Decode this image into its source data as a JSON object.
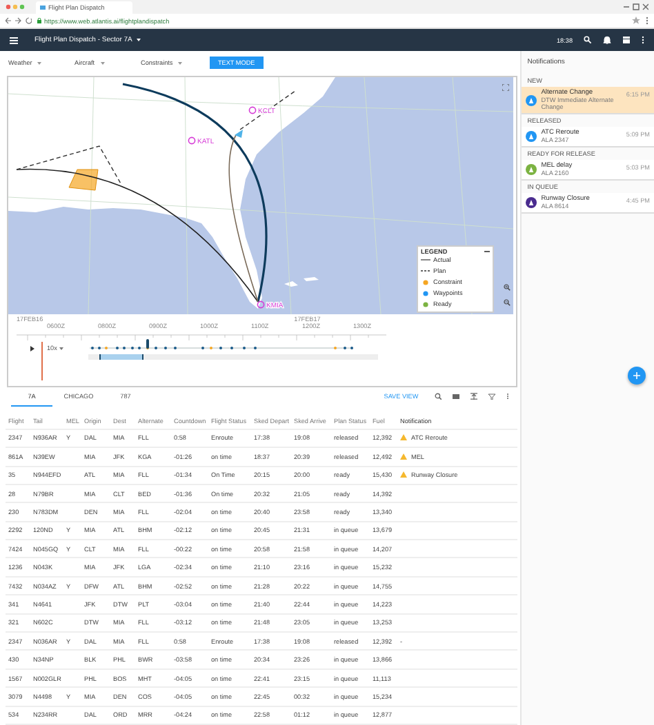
{
  "browser": {
    "tab_title": "Flight Plan Dispatch",
    "url": "https://www.web.atlantis.ai/flightplandispatch"
  },
  "app_bar": {
    "title": "Flight Plan Dispatch - Sector 7A",
    "time": "18:38"
  },
  "toolbar": {
    "menus": [
      "Weather",
      "Aircraft",
      "Constraints"
    ],
    "button": "TEXT MODE"
  },
  "map": {
    "airports": [
      {
        "code": "KCLT"
      },
      {
        "code": "KATL"
      },
      {
        "code": "KMIA"
      }
    ],
    "legend": {
      "title": "LEGEND",
      "items": [
        {
          "kind": "solid",
          "label": "Actual"
        },
        {
          "kind": "dashed",
          "label": "Plan"
        },
        {
          "kind": "dot",
          "color": "#f5a623",
          "label": "Constraint"
        },
        {
          "kind": "dot",
          "color": "#2196f3",
          "label": "Waypoints"
        },
        {
          "kind": "dot",
          "color": "#7cb342",
          "label": "Ready"
        }
      ]
    }
  },
  "timeline": {
    "dates": [
      "17FEB16",
      "17FEB17"
    ],
    "ticks": [
      "0600Z",
      "0800Z",
      "0900Z",
      "1000Z",
      "1100Z",
      "1200Z",
      "1300Z"
    ],
    "speed": "10x",
    "level": 0.15
  },
  "tabs": [
    {
      "label": "7A",
      "selected": true
    },
    {
      "label": "CHICAGO",
      "selected": false
    },
    {
      "label": "787",
      "selected": false
    }
  ],
  "save_view": "SAVE VIEW",
  "table": {
    "columns": [
      "Flight",
      "Tail",
      "MEL",
      "Origin",
      "Dest",
      "Alternate",
      "Countdown",
      "Flight Status",
      "Sked Depart",
      "Sked Arrive",
      "Plan Status",
      "Fuel",
      "Notification"
    ],
    "rows": [
      {
        "flight": "2347",
        "tail": "N936AR",
        "mel": "Y",
        "origin": "DAL",
        "dest": "MIA",
        "alternate": "FLL",
        "countdown": "0:58",
        "flight_status": "Enroute",
        "sked_depart": "17:38",
        "sked_arrive": "19:08",
        "plan_status": "released",
        "fuel": "12,392",
        "notification": {
          "text": "ATC Reroute",
          "warning": true
        }
      },
      {
        "flight": "861A",
        "tail": "N39EW",
        "origin": "MIA",
        "dest": "JFK",
        "alternate": "KGA",
        "countdown": "-01:26",
        "flight_status": "on time",
        "sked_depart": "18:37",
        "sked_arrive": "20:39",
        "plan_status": "released",
        "fuel": "12,492",
        "notification": {
          "text": "MEL",
          "warning": true
        }
      },
      {
        "flight": "35",
        "tail": "N944EFD",
        "origin": "ATL",
        "dest": "MIA",
        "alternate": "FLL",
        "countdown": "-01:34",
        "flight_status": "On Time",
        "sked_depart": "20:15",
        "sked_arrive": "20:00",
        "plan_status": "ready",
        "fuel": "15,430",
        "notification": {
          "text": "Runway Closure",
          "warning": true
        }
      },
      {
        "flight": "28",
        "tail": "N79BR",
        "origin": "MIA",
        "dest": "CLT",
        "alternate": "BED",
        "countdown": "-01:36",
        "flight_status": "On time",
        "sked_depart": "20:32",
        "sked_arrive": "21:05",
        "plan_status": "ready",
        "fuel": "14,392"
      },
      {
        "flight": "230",
        "tail": "N783DM",
        "origin": "DEN",
        "dest": "MIA",
        "alternate": "FLL",
        "countdown": "-02:04",
        "flight_status": "on time",
        "sked_depart": "20:40",
        "sked_arrive": "23:58",
        "plan_status": "ready",
        "fuel": "13,340"
      },
      {
        "flight": "2292",
        "tail": "120ND",
        "mel": "Y",
        "origin": "MIA",
        "dest": "ATL",
        "alternate": "BHM",
        "countdown": "-02:12",
        "flight_status": "on time",
        "sked_depart": "20:45",
        "sked_arrive": "21:31",
        "plan_status": "in queue",
        "fuel": "13,679"
      },
      {
        "flight": "7424",
        "tail": "N045GQ",
        "mel": "Y",
        "origin": "CLT",
        "dest": "MIA",
        "alternate": "FLL",
        "countdown": "-00:22",
        "flight_status": "on time",
        "sked_depart": "20:58",
        "sked_arrive": "21:58",
        "plan_status": "in queue",
        "fuel": "14,207"
      },
      {
        "flight": "1236",
        "tail": "N043K",
        "origin": "MIA",
        "dest": "JFK",
        "alternate": "LGA",
        "countdown": "-02:34",
        "flight_status": "on time",
        "sked_depart": "21:10",
        "sked_arrive": "23:16",
        "plan_status": "in queue",
        "fuel": "15,232"
      },
      {
        "flight": "7432",
        "tail": "N034AZ",
        "mel": "Y",
        "origin": "DFW",
        "dest": "ATL",
        "alternate": "BHM",
        "countdown": "-02:52",
        "flight_status": "on time",
        "sked_depart": "21:28",
        "sked_arrive": "20:22",
        "plan_status": "in queue",
        "fuel": "14,755"
      },
      {
        "flight": "341",
        "tail": "N4641",
        "origin": "JFK",
        "dest": "DTW",
        "alternate": "PLT",
        "countdown": "-03:04",
        "flight_status": "on time",
        "sked_depart": "21:40",
        "sked_arrive": "22:44",
        "plan_status": "in queue",
        "fuel": "14,223"
      },
      {
        "flight": "321",
        "tail": "N602C",
        "origin": "DTW",
        "dest": "MIA",
        "alternate": "FLL",
        "countdown": "-03:12",
        "flight_status": "on time",
        "sked_depart": "21:48",
        "sked_arrive": "23:05",
        "plan_status": "in queue",
        "fuel": "13,253"
      },
      {
        "flight": "2347",
        "tail": "N036AR",
        "mel": "Y",
        "origin": "DAL",
        "dest": "MIA",
        "alternate": "FLL",
        "countdown": "0:58",
        "flight_status": "Enroute",
        "sked_depart": "17:38",
        "sked_arrive": "19:08",
        "plan_status": "released",
        "fuel": "12,392",
        "notification": {
          "text": "-",
          "warning": false
        }
      },
      {
        "flight": "430",
        "tail": "N34NP",
        "origin": "BLK",
        "dest": "PHL",
        "alternate": "BWR",
        "countdown": "-03:58",
        "flight_status": "on time",
        "sked_depart": "20:34",
        "sked_arrive": "23:26",
        "plan_status": "in queue",
        "fuel": "13,866"
      },
      {
        "flight": "1567",
        "tail": "N002GLR",
        "origin": "PHL",
        "dest": "BOS",
        "alternate": "MHT",
        "countdown": "-04:05",
        "flight_status": "on time",
        "sked_depart": "22:41",
        "sked_arrive": "23:15",
        "plan_status": "in queue",
        "fuel": "11,113"
      },
      {
        "flight": "3079",
        "tail": "N4498",
        "mel": "Y",
        "origin": "MIA",
        "dest": "DEN",
        "alternate": "COS",
        "countdown": "-04:05",
        "flight_status": "on time",
        "sked_depart": "22:45",
        "sked_arrive": "00:32",
        "plan_status": "in queue",
        "fuel": "15,234"
      },
      {
        "flight": "534",
        "tail": "N234RR",
        "origin": "DAL",
        "dest": "ORD",
        "alternate": "MRR",
        "countdown": "-04:24",
        "flight_status": "on time",
        "sked_depart": "22:58",
        "sked_arrive": "01:12",
        "plan_status": "in queue",
        "fuel": "12,877"
      }
    ]
  },
  "notifications": {
    "title": "Notifications",
    "groups": [
      {
        "heading": "NEW",
        "items": [
          {
            "title": "Alternate Change",
            "subtitle": "DTW Immediate Alternate Change",
            "time": "6:15 PM",
            "color": "#2196f3",
            "highlighted": true
          }
        ]
      },
      {
        "heading": "RELEASED",
        "items": [
          {
            "title": "ATC Reroute",
            "subtitle": "ALA 2347",
            "time": "5:09 PM",
            "color": "#2196f3",
            "highlighted": false
          }
        ]
      },
      {
        "heading": "READY FOR RELEASE",
        "items": [
          {
            "title": "MEL delay",
            "subtitle": "ALA 2160",
            "time": "5:03 PM",
            "color": "#7cb342",
            "highlighted": false
          }
        ]
      },
      {
        "heading": "IN QUEUE",
        "items": [
          {
            "title": "Runway Closure",
            "subtitle": "ALA 8614",
            "time": "4:45 PM",
            "color": "#4a2c8f",
            "highlighted": false
          }
        ]
      }
    ]
  }
}
